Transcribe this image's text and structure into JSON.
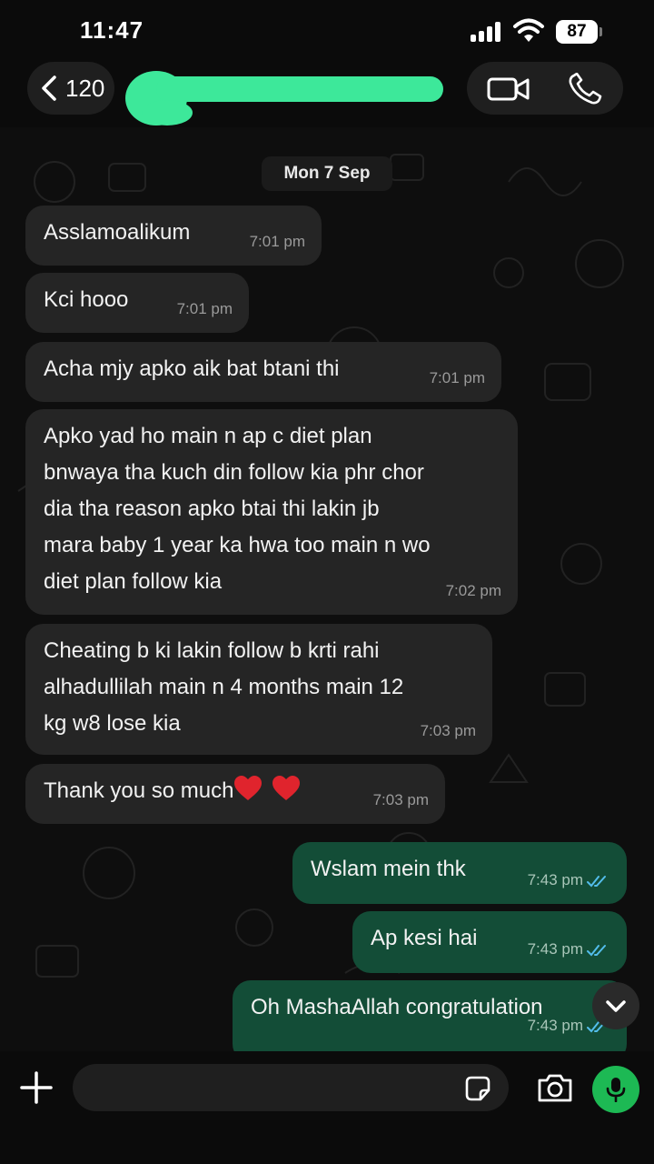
{
  "status_bar": {
    "time": "11:47",
    "battery": "87"
  },
  "header": {
    "back_count": "120"
  },
  "chat": {
    "date": "Mon 7 Sep",
    "messages": [
      {
        "dir": "in",
        "lines": [
          "Asslamoalikum"
        ],
        "time": "7:01 pm"
      },
      {
        "dir": "in",
        "lines": [
          "Kci hooo"
        ],
        "time": "7:01 pm"
      },
      {
        "dir": "in",
        "lines": [
          "Acha mjy apko aik bat btani thi"
        ],
        "time": "7:01 pm"
      },
      {
        "dir": "in",
        "lines": [
          "Apko yad ho main n ap c diet plan",
          "bnwaya tha kuch din follow kia phr chor",
          "dia tha reason apko btai thi lakin jb",
          "mara baby 1 year ka hwa too main n wo",
          "diet plan follow kia"
        ],
        "time": "7:02 pm"
      },
      {
        "dir": "in",
        "lines": [
          "Cheating b ki lakin follow b krti rahi",
          "alhadullilah main n 4 months main 12",
          "kg w8 lose kia"
        ],
        "time": "7:03 pm"
      },
      {
        "dir": "in",
        "lines": [
          "Thank you so much"
        ],
        "time": "7:03 pm",
        "hearts": 2
      },
      {
        "dir": "out",
        "lines": [
          "Wslam mein thk"
        ],
        "time": "7:43 pm",
        "read": true
      },
      {
        "dir": "out",
        "lines": [
          "Ap kesi hai"
        ],
        "time": "7:43 pm",
        "read": true
      },
      {
        "dir": "out",
        "lines": [
          "Oh MashaAllah congratulation"
        ],
        "time": "7:43 pm",
        "read": true
      }
    ]
  },
  "colors": {
    "incoming": "#252525",
    "outgoing": "#134d37",
    "accent": "#1db954",
    "read_ticks": "#53bdeb"
  },
  "icons": [
    "back-chevron-icon",
    "video-call-icon",
    "phone-icon",
    "scroll-down-icon",
    "plus-icon",
    "sticker-icon",
    "camera-icon",
    "mic-icon"
  ]
}
